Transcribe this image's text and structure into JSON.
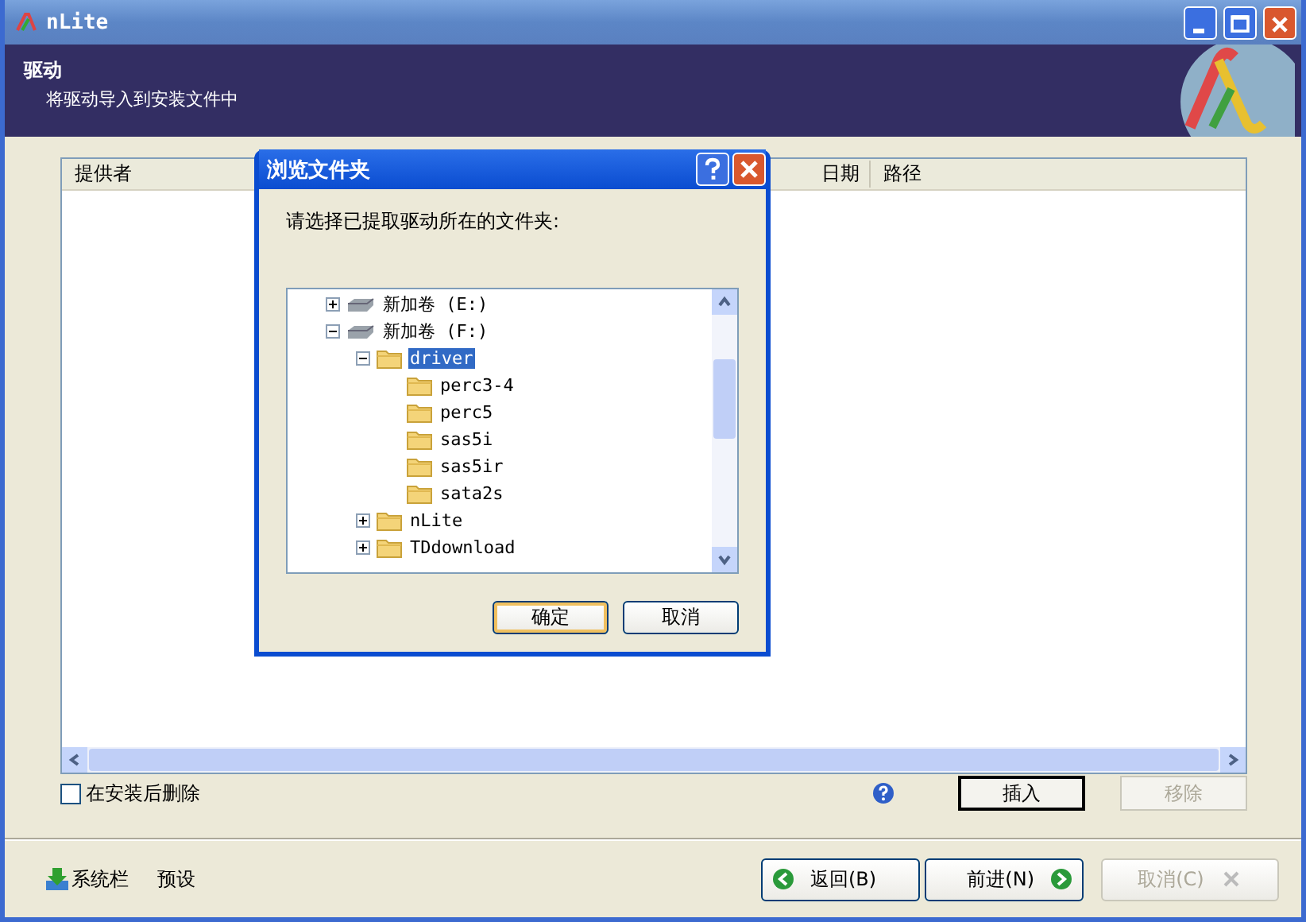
{
  "window": {
    "title": "nLite"
  },
  "header": {
    "title": "驱动",
    "subtitle": "将驱动导入到安装文件中"
  },
  "driver_list": {
    "columns": [
      "提供者",
      "日期",
      "路径"
    ]
  },
  "delete_after_install": {
    "label": "在安装后删除",
    "checked": false
  },
  "list_buttons": [
    {
      "label": "插入",
      "default": true,
      "disabled": false
    },
    {
      "label": "移除",
      "default": false,
      "disabled": true
    }
  ],
  "footer_links": [
    {
      "label": "系统栏",
      "kind": "tray"
    },
    {
      "label": "预设",
      "kind": "plain"
    }
  ],
  "nav_buttons": [
    {
      "label": "返回(B)",
      "kind": "back",
      "disabled": false
    },
    {
      "label": "前进(N)",
      "kind": "next",
      "disabled": false
    },
    {
      "label": "取消(C)",
      "kind": "cancel",
      "disabled": true
    }
  ],
  "dialog": {
    "title": "浏览文件夹",
    "prompt": "请选择已提取驱动所在的文件夹:",
    "tree": [
      {
        "label": "新加卷 (E:)",
        "kind": "drive",
        "expanded": false,
        "selected": false
      },
      {
        "label": "新加卷 (F:)",
        "kind": "drive",
        "expanded": true,
        "selected": false,
        "children": [
          {
            "label": "driver",
            "kind": "folder",
            "expanded": true,
            "selected": true,
            "children": [
              {
                "label": "perc3-4",
                "kind": "folder",
                "selected": false
              },
              {
                "label": "perc5",
                "kind": "folder",
                "selected": false
              },
              {
                "label": "sas5i",
                "kind": "folder",
                "selected": false
              },
              {
                "label": "sas5ir",
                "kind": "folder",
                "selected": false
              },
              {
                "label": "sata2s",
                "kind": "folder",
                "selected": false
              }
            ]
          },
          {
            "label": "nLite",
            "kind": "folder",
            "expanded": false,
            "selected": false
          },
          {
            "label": "TDdownload",
            "kind": "folder",
            "expanded": false,
            "selected": false
          }
        ]
      }
    ],
    "buttons": [
      {
        "label": "确定",
        "default": true
      },
      {
        "label": "取消",
        "default": false
      }
    ]
  }
}
